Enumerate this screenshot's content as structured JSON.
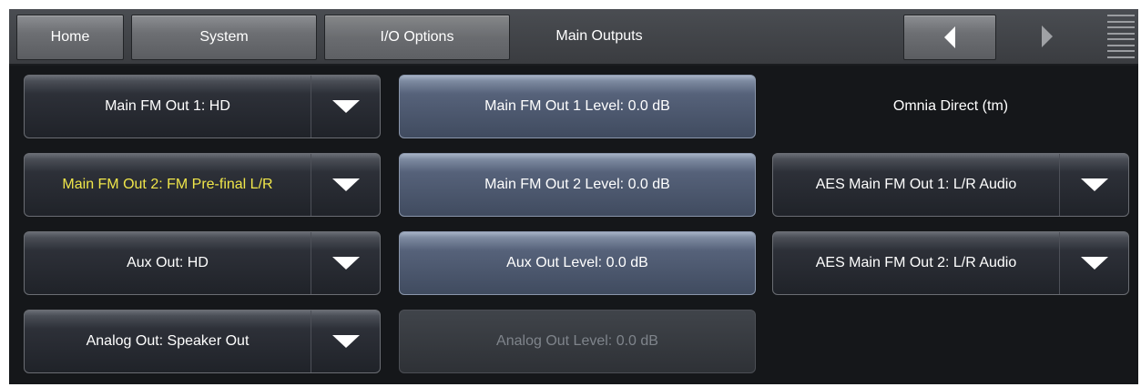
{
  "nav": {
    "home": "Home",
    "system": "System",
    "io_options": "I/O Options",
    "current": "Main Outputs"
  },
  "column1": [
    {
      "label": "Main FM Out 1: HD"
    },
    {
      "label": "Main FM Out 2: FM Pre-final L/R"
    },
    {
      "label": "Aux Out: HD"
    },
    {
      "label": "Analog Out: Speaker Out"
    }
  ],
  "column2": [
    {
      "label": "Main FM Out 1 Level: 0.0 dB"
    },
    {
      "label": "Main FM Out 2 Level: 0.0 dB"
    },
    {
      "label": "Aux Out Level: 0.0 dB"
    },
    {
      "label": "Analog Out Level: 0.0 dB"
    }
  ],
  "column3": {
    "header": "Omnia Direct (tm)",
    "items": [
      {
        "label": "AES Main FM Out 1: L/R Audio"
      },
      {
        "label": "AES Main FM Out 2: L/R Audio"
      }
    ]
  },
  "colors": {
    "highlight_text": "#f0e64a",
    "disabled_text": "#7f848b",
    "background": "#15171a"
  },
  "icons": {
    "dropdown": "caret-down-icon",
    "back": "arrow-left-icon",
    "forward": "arrow-right-icon",
    "menu": "menu-icon"
  }
}
